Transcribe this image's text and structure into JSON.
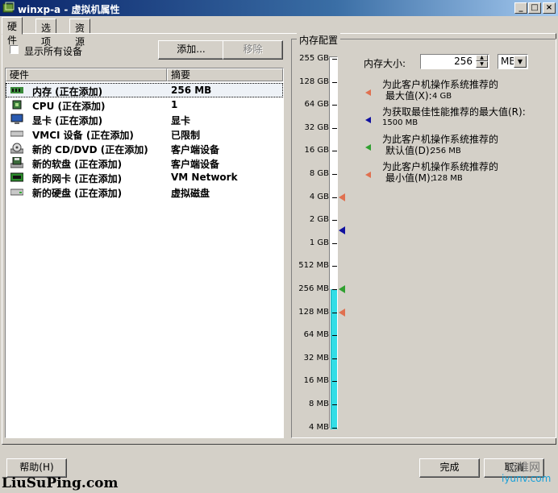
{
  "window": {
    "title": "winxp-a - 虚拟机属性",
    "minimize": "_",
    "maximize": "□",
    "close": "×"
  },
  "tabs": [
    {
      "label": "硬件"
    },
    {
      "label": "选项"
    },
    {
      "label": "资源"
    }
  ],
  "hardware": {
    "show_all_label": "显示所有设备",
    "add_button": "添加...",
    "remove_button": "移除",
    "col_hardware": "硬件",
    "col_summary": "摘要",
    "rows": [
      {
        "icon": "memory-icon",
        "name": "内存 (正在添加)",
        "summary": "256 MB"
      },
      {
        "icon": "cpu-icon",
        "name": "CPU (正在添加)",
        "summary": "1"
      },
      {
        "icon": "display-icon",
        "name": "显卡 (正在添加)",
        "summary": "显卡"
      },
      {
        "icon": "vmci-icon",
        "name": "VMCI 设备 (正在添加)",
        "summary": "已限制"
      },
      {
        "icon": "cd-dvd-icon",
        "name": "新的 CD/DVD (正在添加)",
        "summary": "客户端设备"
      },
      {
        "icon": "floppy-icon",
        "name": "新的软盘 (正在添加)",
        "summary": "客户端设备"
      },
      {
        "icon": "network-icon",
        "name": "新的网卡 (正在添加)",
        "summary": "VM Network"
      },
      {
        "icon": "hard-disk-icon",
        "name": "新的硬盘 (正在添加)",
        "summary": "虚拟磁盘"
      }
    ]
  },
  "memory": {
    "group_title": "内存配置",
    "size_label": "内存大小:",
    "size_value": "256",
    "size_mb": 256,
    "unit": "MB",
    "scale": [
      "255 GB",
      "128 GB",
      "64 GB",
      "32 GB",
      "16 GB",
      "8 GB",
      "4 GB",
      "2 GB",
      "1 GB",
      "512 MB",
      "256 MB",
      "128 MB",
      "64 MB",
      "32 MB",
      "16 MB",
      "8 MB",
      "4 MB"
    ],
    "markers": [
      {
        "name": "max-recommended",
        "value_mb": 4096,
        "color": "#e07050"
      },
      {
        "name": "best-performance",
        "value_mb": 1500,
        "color": "#1010a0"
      },
      {
        "name": "default-recommended",
        "value_mb": 256,
        "color": "#30a030"
      },
      {
        "name": "min-recommended",
        "value_mb": 128,
        "color": "#e07050"
      }
    ],
    "legend": [
      {
        "color": "#e07050",
        "line1": "为此客户机操作系统推荐的",
        "line2": "最大值(X):",
        "value": "4 GB"
      },
      {
        "color": "#1010a0",
        "line1": "为获取最佳性能推荐的最大值(R):",
        "line2": "",
        "value": "1500 MB"
      },
      {
        "color": "#30a030",
        "line1": "为此客户机操作系统推荐的",
        "line2": "默认值(D):",
        "value": "256 MB"
      },
      {
        "color": "#e07050",
        "line1": "为此客户机操作系统推荐的",
        "line2": "最小值(M):",
        "value": "128 MB"
      }
    ]
  },
  "footer": {
    "help": "帮助(H)",
    "finish": "完成",
    "cancel": "取消"
  },
  "watermark": {
    "site": "LiuSuPing.com",
    "brand": "运维网",
    "url": "iyunv.com"
  }
}
